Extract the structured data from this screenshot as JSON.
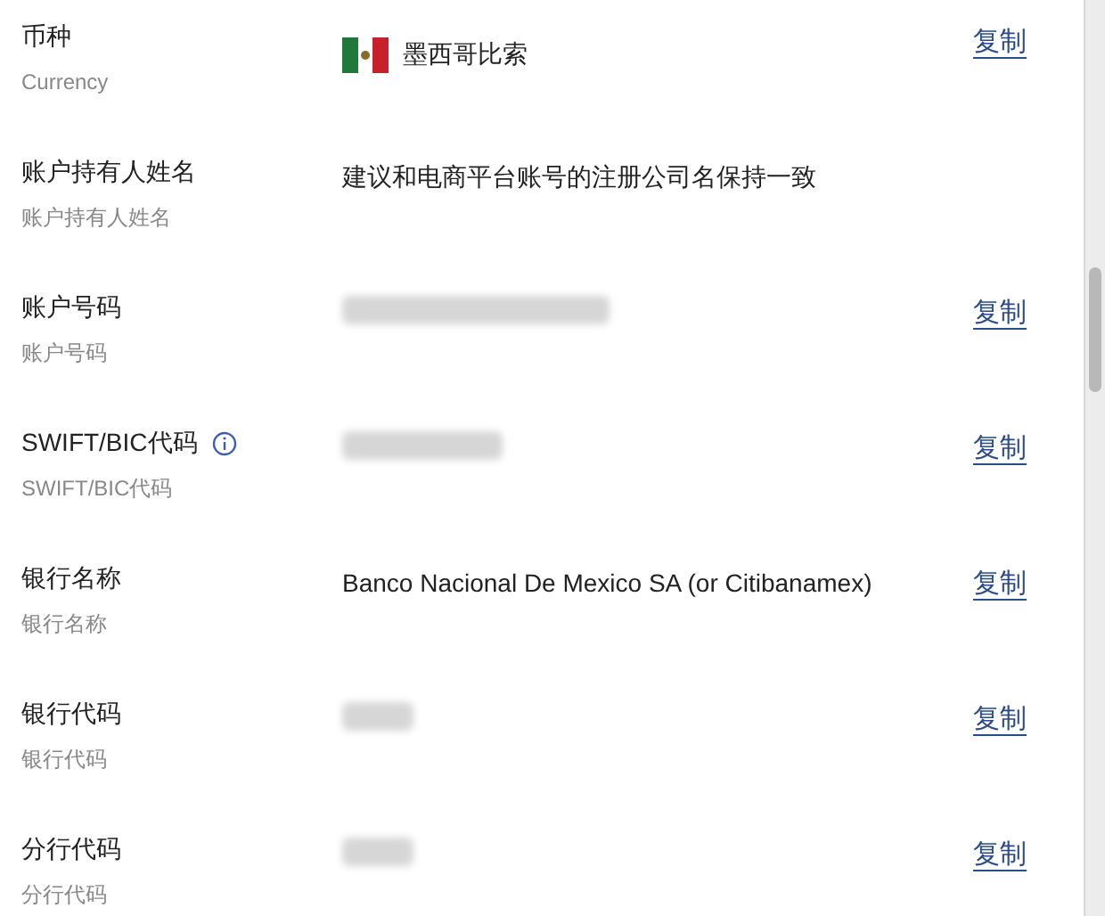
{
  "fields": [
    {
      "label": "币种",
      "sublabel": "Currency",
      "value": {
        "kind": "flag",
        "text": "墨西哥比索"
      },
      "copy": "复制"
    },
    {
      "label": "账户持有人姓名",
      "sublabel": "账户持有人姓名",
      "value": {
        "kind": "text",
        "text": "建议和电商平台账号的注册公司名保持一致"
      }
    },
    {
      "label": "账户号码",
      "sublabel": "账户号码",
      "value": {
        "kind": "redacted"
      },
      "copy": "复制"
    },
    {
      "label": "SWIFT/BIC代码",
      "sublabel": "SWIFT/BIC代码",
      "info": true,
      "value": {
        "kind": "redacted"
      },
      "copy": "复制"
    },
    {
      "label": "银行名称",
      "sublabel": "银行名称",
      "value": {
        "kind": "text",
        "text": "Banco Nacional De Mexico SA (or Citibanamex)"
      },
      "copy": "复制"
    },
    {
      "label": "银行代码",
      "sublabel": "银行代码",
      "value": {
        "kind": "redacted"
      },
      "copy": "复制"
    },
    {
      "label": "分行代码",
      "sublabel": "分行代码",
      "value": {
        "kind": "redacted"
      },
      "copy": "复制"
    }
  ]
}
